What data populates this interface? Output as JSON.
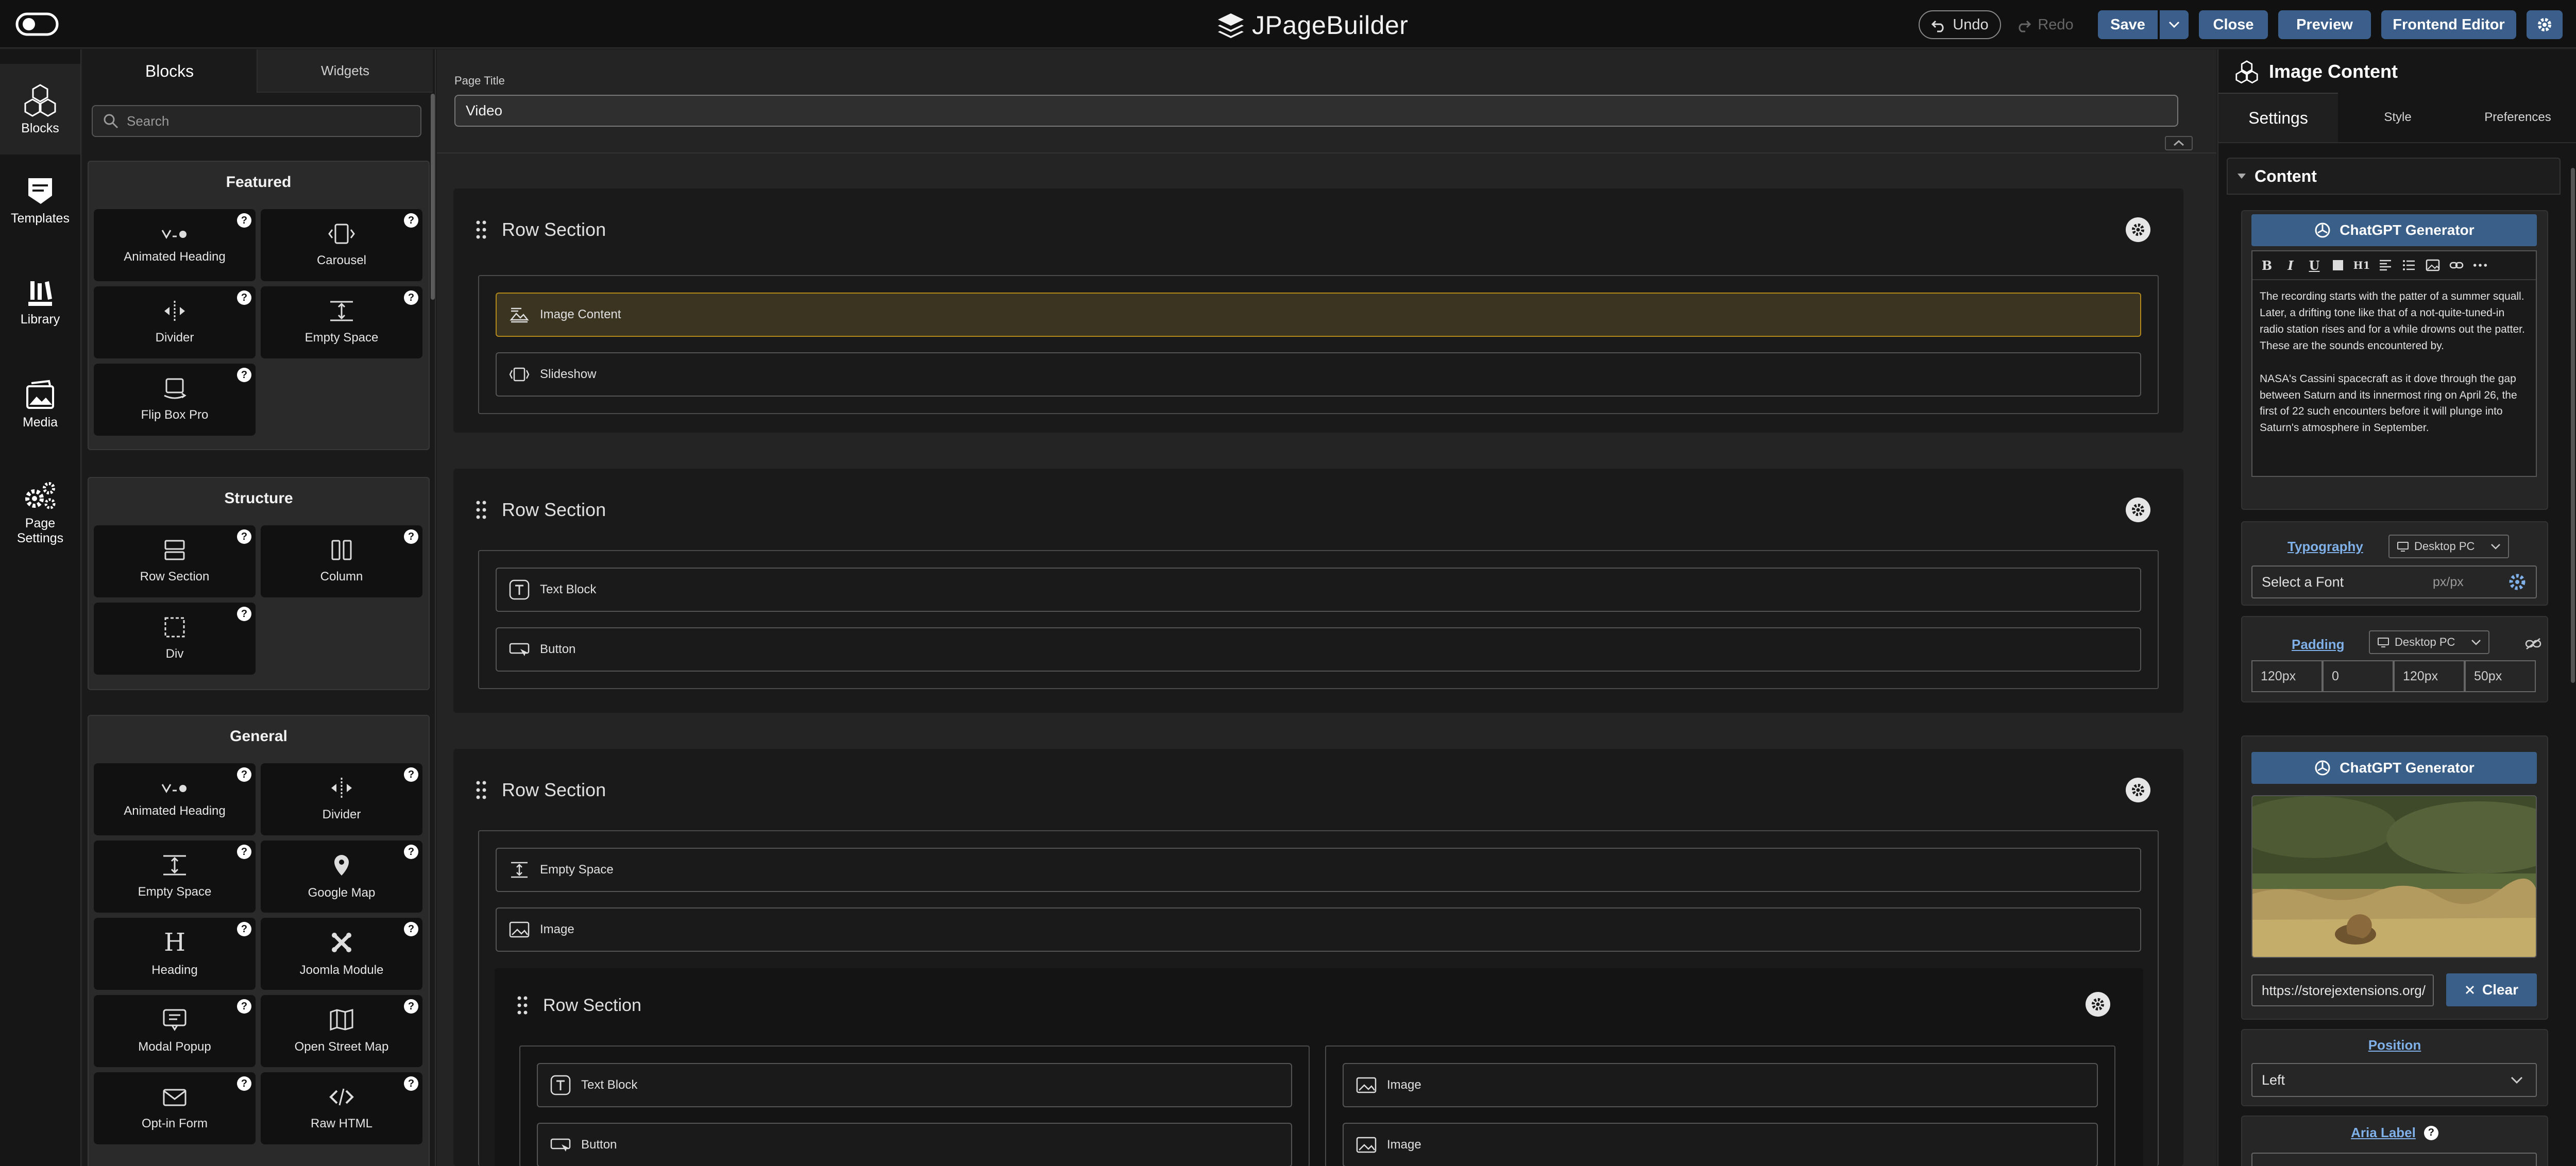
{
  "topbar": {
    "brand": "JPageBuilder",
    "undo": "Undo",
    "redo": "Redo",
    "save": "Save",
    "close": "Close",
    "preview": "Preview",
    "frontend_editor": "Frontend Editor"
  },
  "rail": {
    "items": [
      {
        "label": "Blocks",
        "icon": "blocks-icon"
      },
      {
        "label": "Templates",
        "icon": "templates-icon"
      },
      {
        "label": "Library",
        "icon": "library-icon"
      },
      {
        "label": "Media",
        "icon": "media-icon"
      },
      {
        "label": "Page Settings",
        "icon": "page-settings-icon"
      }
    ]
  },
  "blocks_panel": {
    "tabs": [
      "Blocks",
      "Widgets"
    ],
    "search_placeholder": "Search",
    "groups": [
      {
        "title": "Featured",
        "items": [
          "Animated Heading",
          "Carousel",
          "Divider",
          "Empty Space",
          "Flip Box Pro"
        ]
      },
      {
        "title": "Structure",
        "items": [
          "Row Section",
          "Column",
          "Div"
        ]
      },
      {
        "title": "General",
        "items": [
          "Animated Heading",
          "Divider",
          "Empty Space",
          "Google Map",
          "Heading",
          "Joomla Module",
          "Modal Popup",
          "Open Street Map",
          "Opt-in Form",
          "Raw HTML"
        ]
      }
    ]
  },
  "canvas": {
    "page_title_label": "Page Title",
    "page_title_value": "Video",
    "sections": [
      {
        "title": "Row Section",
        "addons": [
          "Image Content",
          "Slideshow"
        ]
      },
      {
        "title": "Row Section",
        "addons": [
          "Text Block",
          "Button"
        ]
      },
      {
        "title": "Row Section",
        "addons": [
          "Empty Space",
          "Image"
        ],
        "inner": {
          "title": "Row Section",
          "left": [
            "Text Block",
            "Button"
          ],
          "right": [
            "Image",
            "Image"
          ]
        }
      }
    ]
  },
  "settings": {
    "title": "Image Content",
    "tabs": [
      "Settings",
      "Style",
      "Preferences"
    ],
    "content_header": "Content",
    "chatgpt_label": "ChatGPT Generator",
    "editor_paragraphs": [
      "The recording starts with the patter of a summer squall. Later, a drifting tone like that of a not-quite-tuned-in radio station rises and for a while drowns out the patter. These are the sounds encountered by.",
      "NASA's Cassini spacecraft as it dove through the gap between Saturn and its innermost ring on April 26, the first of 22 such encounters before it will plunge into Saturn's atmosphere in September."
    ],
    "typography_label": "Typography",
    "device_label": "Desktop PC",
    "font_placeholder": "Select a Font",
    "font_unit": "px/px",
    "padding_label": "Padding",
    "padding_values": [
      "120px",
      "0",
      "120px",
      "50px"
    ],
    "image_url": "https://storejextensions.org/",
    "clear_label": "Clear",
    "position_label": "Position",
    "position_value": "Left",
    "aria_label": "Aria Label"
  },
  "colors": {
    "accent_blue": "#3b5f8a",
    "selected_addon": "#3a3420",
    "link_blue": "#7fb0e8"
  }
}
